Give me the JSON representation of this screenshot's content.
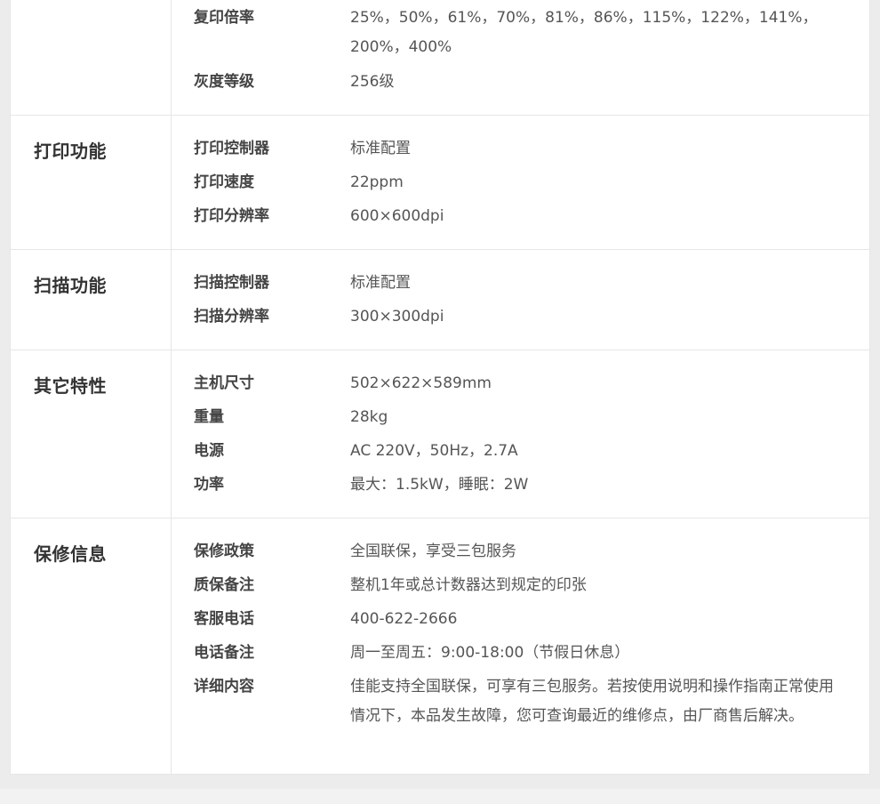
{
  "sections": [
    {
      "title": "",
      "rows": [
        {
          "key": "复印倍率",
          "value": "25%，50%，61%，70%，81%，86%，115%，122%，141%，200%，400%"
        },
        {
          "key": "灰度等级",
          "value": "256级"
        }
      ]
    },
    {
      "title": "打印功能",
      "rows": [
        {
          "key": "打印控制器",
          "value": "标准配置"
        },
        {
          "key": "打印速度",
          "value": "22ppm"
        },
        {
          "key": "打印分辨率",
          "value": "600×600dpi"
        }
      ]
    },
    {
      "title": "扫描功能",
      "rows": [
        {
          "key": "扫描控制器",
          "value": "标准配置"
        },
        {
          "key": "扫描分辨率",
          "value": "300×300dpi"
        }
      ]
    },
    {
      "title": "其它特性",
      "rows": [
        {
          "key": "主机尺寸",
          "value": "502×622×589mm"
        },
        {
          "key": "重量",
          "value": "28kg"
        },
        {
          "key": "电源",
          "value": "AC 220V，50Hz，2.7A"
        },
        {
          "key": "功率",
          "value": "最大：1.5kW，睡眠：2W"
        }
      ]
    },
    {
      "title": "保修信息",
      "rows": [
        {
          "key": "保修政策",
          "value": "全国联保，享受三包服务"
        },
        {
          "key": "质保备注",
          "value": "整机1年或总计数器达到规定的印张"
        },
        {
          "key": "客服电话",
          "value": "400-622-2666"
        },
        {
          "key": "电话备注",
          "value": "周一至周五：9:00-18:00（节假日休息）"
        },
        {
          "key": "详细内容",
          "value": "佳能支持全国联保，可享有三包服务。若按使用说明和操作指南正常使用情况下，本品发生故障，您可查询最近的维修点，由厂商售后解决。"
        }
      ]
    }
  ]
}
